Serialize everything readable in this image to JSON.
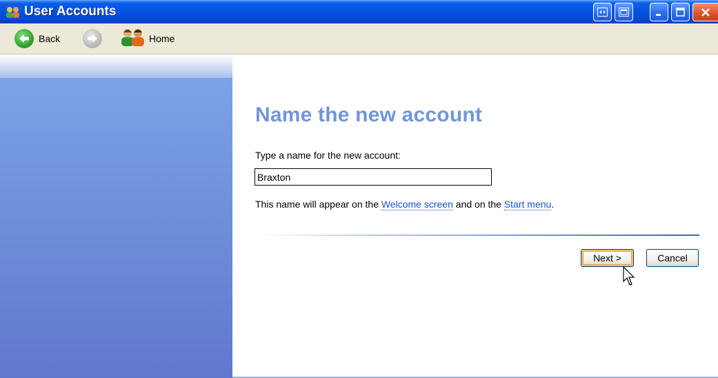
{
  "window": {
    "title": "User Accounts",
    "app_icon": "user-accounts-icon",
    "controls": [
      "switch-view-icon",
      "restore-view-icon",
      "minimize-icon",
      "maximize-icon",
      "close-icon"
    ]
  },
  "toolbar": {
    "back_label": "Back",
    "forward_icon": "forward-arrow-icon",
    "home_label": "Home"
  },
  "main": {
    "title": "Name the new account",
    "prompt": "Type a name for the new account:",
    "name_value": "Braxton",
    "info_prefix": "This name will appear on the ",
    "info_link1": "Welcome screen",
    "info_middle": " and on the ",
    "info_link2": "Start menu",
    "info_suffix": ".",
    "next_label": "Next >",
    "cancel_label": "Cancel"
  },
  "colors": {
    "title_blue": "#7096d8",
    "link_blue": "#1c4fd0",
    "titlebar_blue": "#0550e0",
    "sidebar_blue": "#6f90d9"
  }
}
